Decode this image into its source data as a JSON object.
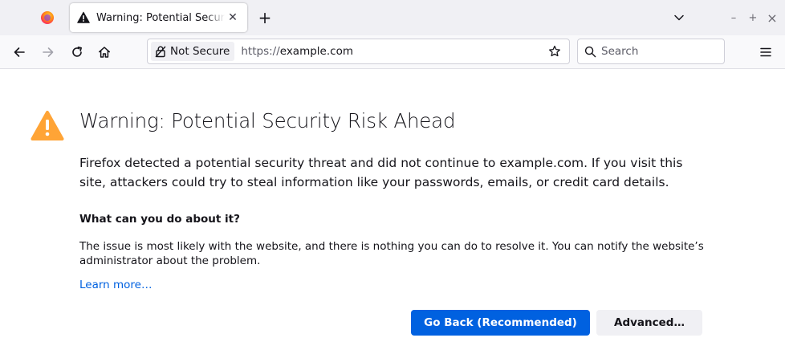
{
  "browser": {
    "tab": {
      "title": "Warning: Potential Security Risk Ahead",
      "icon": "warning-icon",
      "close_label": "✕"
    },
    "new_tab_label": "+",
    "window_controls": {
      "minimize": "–",
      "maximize": "+",
      "close": "×"
    },
    "nav": {
      "back_icon": "arrow-left-icon",
      "forward_icon": "arrow-right-icon",
      "reload_icon": "reload-icon",
      "home_icon": "home-icon"
    },
    "urlbar": {
      "identity_label": "Not Secure",
      "url_scheme": "https://",
      "url_host": "example.com"
    },
    "search": {
      "placeholder": "Search"
    }
  },
  "page": {
    "title": "Warning: Potential Security Risk Ahead",
    "intro": "Firefox detected a potential security threat and did not continue to example.com. If you visit this site, attackers could try to steal information like your passwords, emails, or credit card details.",
    "what_heading": "What can you do about it?",
    "issue_text": "The issue is most likely with the website, and there is nothing you can do to resolve it. You can notify the website’s administrator about the problem.",
    "learn_more": "Learn more…",
    "go_back_label": "Go Back (Recommended)",
    "advanced_label": "Advanced…"
  },
  "colors": {
    "accent": "#0061e0",
    "warning": "#ffa436",
    "tabstrip": "#f0f0f4",
    "toolbar": "#f9f9fb"
  }
}
